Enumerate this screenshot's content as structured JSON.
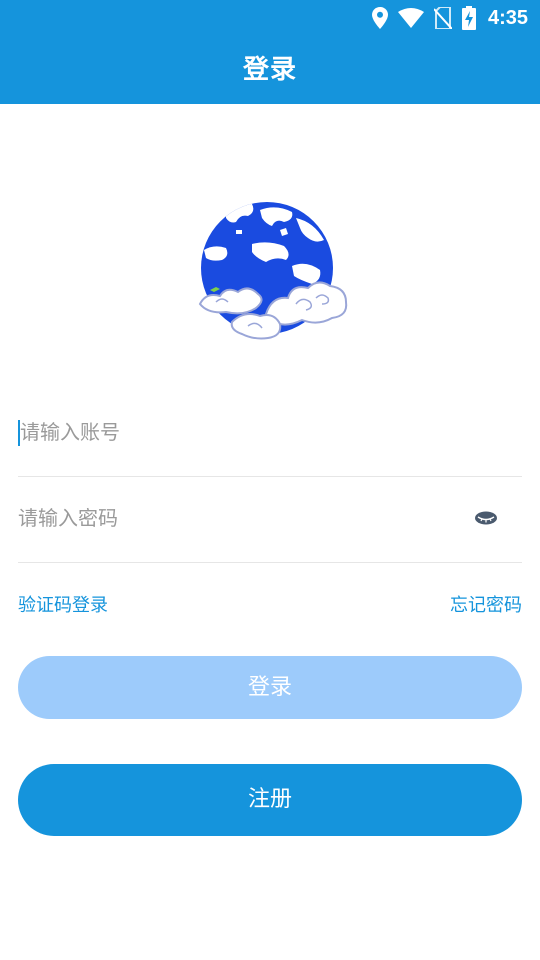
{
  "status_bar": {
    "time": "4:35",
    "icons": [
      "location-icon",
      "wifi-icon",
      "no-sim-icon",
      "battery-charging-icon"
    ]
  },
  "header": {
    "title": "登录"
  },
  "logo": {
    "icon": "globe-clouds-logo"
  },
  "form": {
    "account_placeholder": "请输入账号",
    "password_placeholder": "请输入密码",
    "password_toggle_icon": "eye-closed-icon"
  },
  "links": {
    "code_login": "验证码登录",
    "forgot_password": "忘记密码"
  },
  "buttons": {
    "login": "登录",
    "register": "注册"
  },
  "colors": {
    "primary": "#1594dc",
    "login_button_disabled": "#9dcbfb",
    "divider": "#e6e6e6",
    "placeholder": "#9a9a9a"
  }
}
